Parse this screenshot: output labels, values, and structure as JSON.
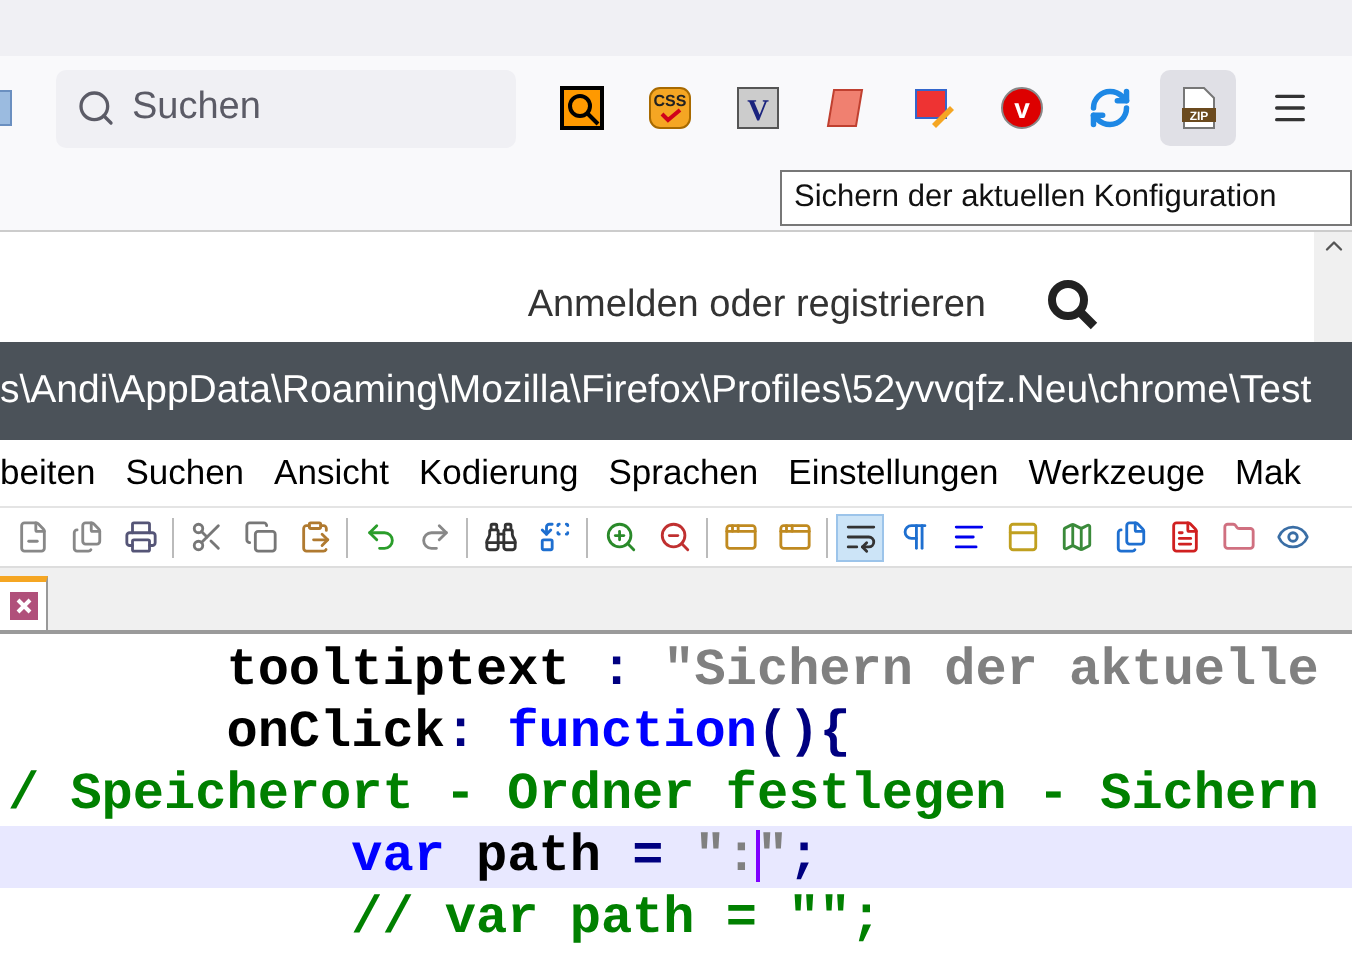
{
  "search": {
    "placeholder": "Suchen"
  },
  "extensions": [
    {
      "kind": "magnifier",
      "hovered": false
    },
    {
      "kind": "badge",
      "label": "CSS",
      "hovered": false
    },
    {
      "kind": "letter",
      "label": "V",
      "hovered": false
    },
    {
      "kind": "scroll",
      "hovered": false
    },
    {
      "kind": "paint",
      "hovered": false
    },
    {
      "kind": "circle",
      "label": "v",
      "hovered": false
    },
    {
      "kind": "sync",
      "hovered": false
    },
    {
      "kind": "zip",
      "label": "ZIP",
      "hovered": true
    }
  ],
  "tooltip": "Sichern der aktuellen Konfiguration",
  "web_page": {
    "login_link": "Anmelden oder registrieren"
  },
  "editor_window": {
    "title": "s\\Andi\\AppData\\Roaming\\Mozilla\\Firefox\\Profiles\\52yvvqfz.Neu\\chrome\\Test",
    "menu": [
      "beiten",
      "Suchen",
      "Ansicht",
      "Kodierung",
      "Sprachen",
      "Einstellungen",
      "Werkzeuge",
      "Mak"
    ],
    "toolbar": [
      {
        "pressed": false
      },
      {
        "pressed": false
      },
      {
        "pressed": false
      },
      {
        "pressed": false
      },
      {
        "pressed": false
      },
      {
        "pressed": false
      },
      {
        "pressed": false
      },
      {
        "pressed": false
      },
      {
        "pressed": false
      },
      {
        "pressed": false
      },
      {
        "pressed": false
      },
      {
        "pressed": false
      },
      {
        "pressed": false
      },
      {
        "pressed": false
      },
      {
        "pressed": true
      },
      {
        "pressed": false
      },
      {
        "pressed": false
      },
      {
        "pressed": false
      },
      {
        "pressed": false
      },
      {
        "pressed": false
      },
      {
        "pressed": false
      },
      {
        "pressed": false
      },
      {
        "pressed": false
      }
    ],
    "tabs": [
      {
        "selected": true
      }
    ],
    "code_lines": [
      {
        "highlighted": false,
        "tokens": [
          {
            "kind": "plain",
            "text": "       tooltiptext"
          },
          {
            "kind": "operator",
            "text": " : "
          },
          {
            "kind": "string",
            "text": "\"Sichern der aktuelle"
          }
        ]
      },
      {
        "highlighted": false,
        "tokens": [
          {
            "kind": "plain",
            "text": "       onClick"
          },
          {
            "kind": "operator",
            "text": ": "
          },
          {
            "kind": "keyword",
            "text": "function"
          },
          {
            "kind": "operator",
            "text": "(){"
          }
        ]
      },
      {
        "highlighted": false,
        "tokens": [
          {
            "kind": "comment",
            "text": "/ Speicherort - Ordner festlegen - Sichern"
          }
        ]
      },
      {
        "highlighted": true,
        "tokens": [
          {
            "kind": "keyword",
            "text": "           var"
          },
          {
            "kind": "plain",
            "text": " path "
          },
          {
            "kind": "operator",
            "text": "= "
          },
          {
            "kind": "string",
            "text": "\":",
            "caret_after": true
          },
          {
            "kind": "string",
            "text": "\""
          },
          {
            "kind": "operator",
            "text": ";"
          }
        ]
      },
      {
        "highlighted": false,
        "tokens": [
          {
            "kind": "comment",
            "text": "           // var path = \"\";"
          }
        ]
      }
    ]
  }
}
